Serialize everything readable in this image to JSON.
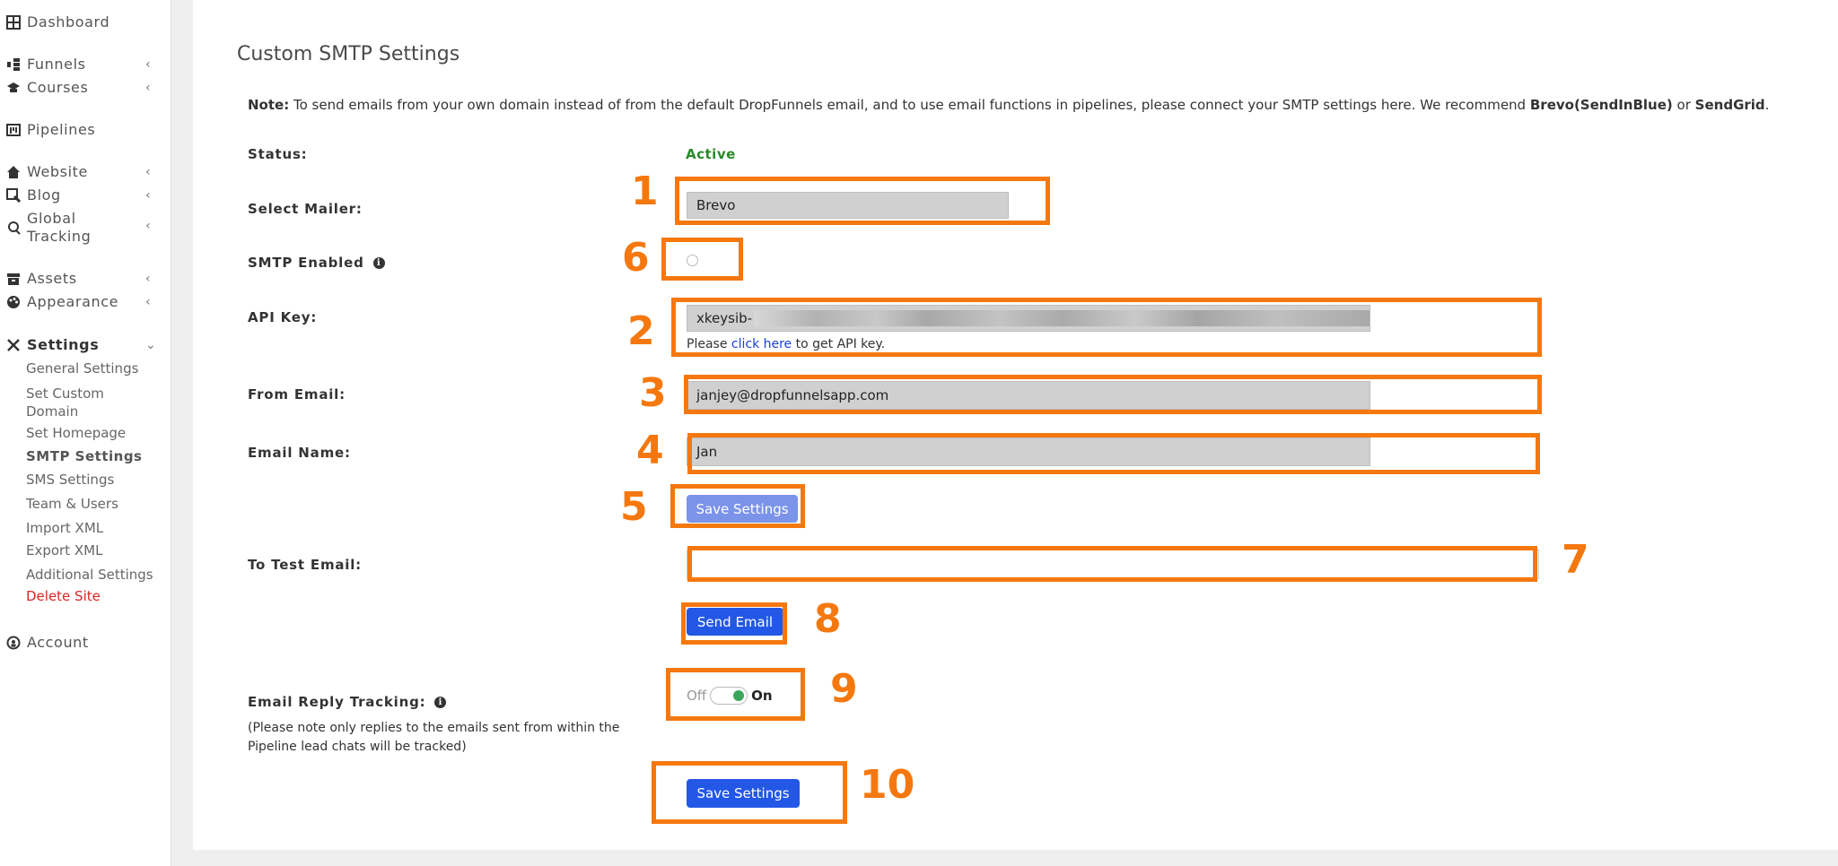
{
  "sidebar": {
    "dashboard": "Dashboard",
    "funnels": "Funnels",
    "courses": "Courses",
    "pipelines": "Pipelines",
    "website": "Website",
    "blog": "Blog",
    "global_tracking_line1": "Global",
    "global_tracking_line2": "Tracking",
    "assets": "Assets",
    "appearance": "Appearance",
    "settings": "Settings",
    "sub": {
      "general": "General Settings",
      "custom_domain_line1": "Set Custom",
      "custom_domain_line2": "Domain",
      "homepage": "Set Homepage",
      "smtp": "SMTP Settings",
      "sms": "SMS Settings",
      "team": "Team & Users",
      "import": "Import XML",
      "export": "Export XML",
      "additional": "Additional Settings",
      "delete": "Delete Site"
    },
    "account": "Account"
  },
  "main": {
    "title": "Custom SMTP Settings",
    "note_label": "Note:",
    "note_text": "To send emails from your own domain instead of from the default DropFunnels email, and to use email functions in pipelines, please connect your SMTP settings here. We recommend",
    "note_rec1": "Brevo(SendInBlue)",
    "note_or": "or",
    "note_rec2": "SendGrid",
    "note_end": ".",
    "status_label": "Status:",
    "status_value": "Active",
    "mailer_label": "Select Mailer:",
    "mailer_value": "Brevo",
    "smtp_enabled_label": "SMTP Enabled",
    "api_key_label": "API Key:",
    "api_key_value": "xkeysib-",
    "api_help_prefix": "Please",
    "api_help_link": "click here",
    "api_help_suffix": "to get API key.",
    "from_email_label": "From Email:",
    "from_email_value": "janjey@dropfunnelsapp.com",
    "email_name_label": "Email Name:",
    "email_name_value": "Jan",
    "save_settings_1": "Save Settings",
    "test_email_label": "To Test Email:",
    "test_email_value": "",
    "send_email": "Send Email",
    "reply_tracking_label": "Email Reply Tracking:",
    "reply_tracking_note_line1": "(Please note only replies to the emails sent from within the",
    "reply_tracking_note_line2": "Pipeline lead chats will be tracked)",
    "toggle_off": "Off",
    "toggle_on": "On",
    "save_settings_2": "Save Settings"
  },
  "annotations": [
    "1",
    "2",
    "3",
    "4",
    "5",
    "6",
    "7",
    "8",
    "9",
    "10"
  ],
  "colors": {
    "annotation": "#f5780f",
    "primary_button": "#2357e6",
    "muted_button": "#7b93e8",
    "active_status": "#2a8a2a",
    "danger": "#e02424"
  }
}
